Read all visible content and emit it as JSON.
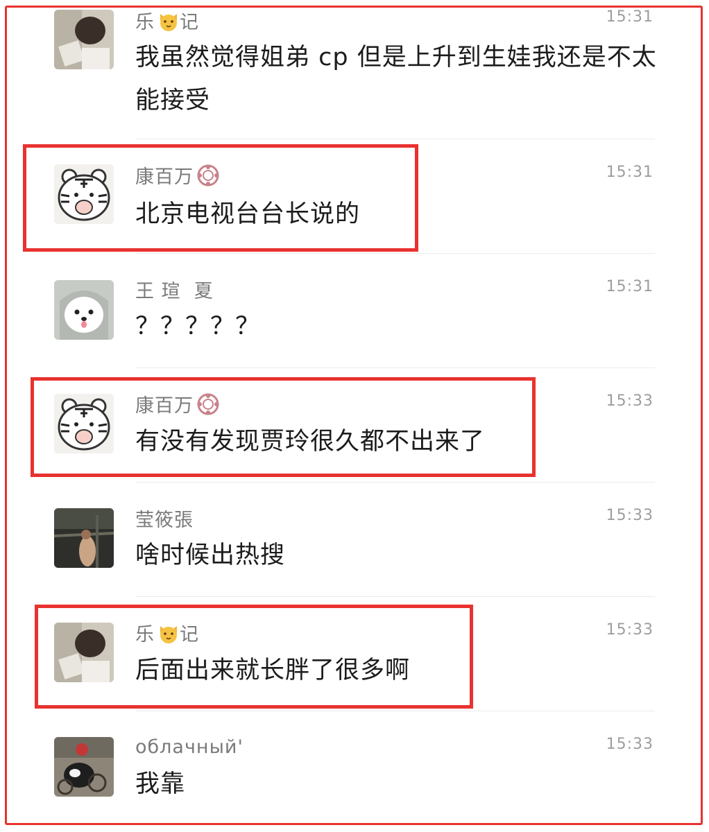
{
  "messages": [
    {
      "name": "乐",
      "name_suffix": "记",
      "badge": "cat-emoji-icon",
      "time": "15:31",
      "text": "我虽然觉得姐弟 cp 但是上升到生娃我还是不太能接受",
      "avatar": "user-photo-avatar",
      "highlighted": false
    },
    {
      "name": "康百万",
      "name_suffix": "",
      "badge": "flower-badge-icon",
      "time": "15:31",
      "text": "北京电视台台长说的",
      "avatar": "tiger-avatar",
      "highlighted": true
    },
    {
      "name": "王 瑄  夏",
      "name_suffix": "",
      "badge": "",
      "time": "15:31",
      "text": "？？？？？",
      "avatar": "puppy-avatar",
      "highlighted": false
    },
    {
      "name": "康百万",
      "name_suffix": "",
      "badge": "flower-badge-icon",
      "time": "15:33",
      "text": "有没有发现贾玲很久都不出来了",
      "avatar": "tiger-avatar",
      "highlighted": true
    },
    {
      "name": "莹筱張",
      "name_suffix": "",
      "badge": "",
      "time": "15:33",
      "text": "啥时候出热搜",
      "avatar": "dark-photo-avatar",
      "highlighted": false
    },
    {
      "name": "乐",
      "name_suffix": "记",
      "badge": "cat-emoji-icon",
      "time": "15:33",
      "text": "后面出来就长胖了很多啊",
      "avatar": "user-photo-avatar",
      "highlighted": true
    },
    {
      "name": "облачный'",
      "name_suffix": "",
      "badge": "",
      "time": "15:33",
      "text": "我靠",
      "avatar": "cat-photo-avatar",
      "highlighted": false
    }
  ],
  "colors": {
    "highlight": "#e8322f",
    "name": "#7a7a7a",
    "time": "#9d9d9d",
    "text": "#1c1c1c"
  }
}
